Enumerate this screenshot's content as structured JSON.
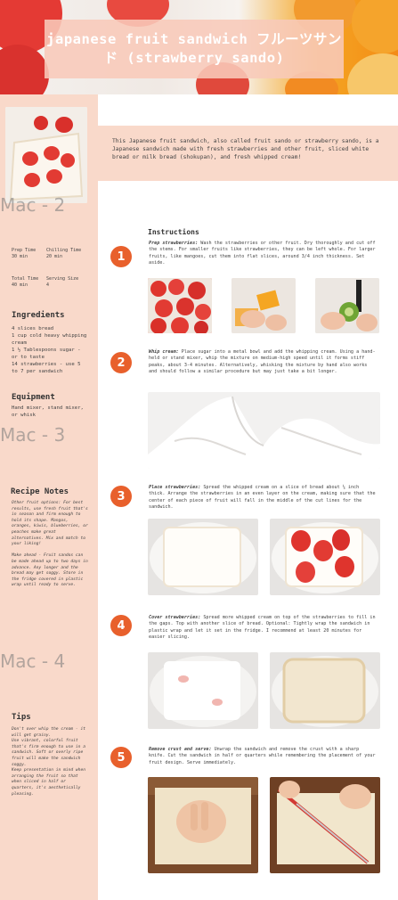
{
  "hero": {
    "title": "japanese fruit sandwich フルーツサンド (strawberry sando)"
  },
  "sidebar": {
    "watermarks": [
      "Mac - 2",
      "Mac - 3",
      "Mac - 4"
    ],
    "meta": {
      "prep_label": "Prep Time",
      "prep_value": "30 min",
      "chill_label": "Chilling Time",
      "chill_value": "20 min",
      "total_label": "Total Time",
      "total_value": "40 min",
      "serving_label": "Serving Size",
      "serving_value": "4"
    },
    "ingredients": {
      "heading": "Ingredients",
      "text": "4 slices bread\n1 cup cold heavy whipping cream\n1 ½ Tablespoons sugar - or to taste\n14 strawberries - use 5 to 7 per sandwich"
    },
    "equipment": {
      "heading": "Equipment",
      "text": "Hand mixer, stand mixer, or whisk"
    },
    "notes": {
      "heading": "Recipe Notes",
      "text": "Other fruit options: For best results, use fresh fruit that's in season and firm enough to hold its shape. Mangos, oranges, kiwis, blueberries, or peaches make great alternatives. Mix and match to your liking!\n\nMake ahead - Fruit sandos can be made ahead up to two days in advance. Any longer and the bread may get soggy. Store in the fridge covered in plastic wrap until ready to serve."
    },
    "tips": {
      "heading": "Tips",
      "text": "Don't over whip the cream - it will get grainy.\nUse vibrant, colorful fruit that's firm enough to use in a sandwich. Soft or overly ripe fruit will make the sandwich soggy.\nKeep presentation in mind when arranging the fruit so that when sliced in half or quarters, it's aesthetically pleasing."
    }
  },
  "intro": {
    "text": "This Japanese fruit sandwich, also called fruit sando or strawberry sando, is a Japanese sandwich made with fresh strawberries and other fruit, sliced white bread or milk bread (shokupan), and fresh whipped cream!"
  },
  "instructions": {
    "heading": "Instructions",
    "steps": [
      {
        "num": "1",
        "title": "Prep strawberries:",
        "text": " Wash the strawberries or other fruit. Dry thoroughly and cut off the stems. For smaller fruits like strawberries, they can be left whole. For larger fruits, like mangoes, cut them into flat slices, around 3/4 inch thickness. Set aside."
      },
      {
        "num": "2",
        "title": "Whip cream:",
        "text": " Place sugar into a metal bowl and add the whipping cream. Using a hand-held or stand mixer, whip the mixture on medium-high speed until it forms stiff peaks, about 3-4 minutes. Alternatively, whisking the mixture by hand also works and should follow a similar procedure but may just take a bit longer."
      },
      {
        "num": "3",
        "title": "Place strawberries:",
        "text": " Spread the whipped cream on a slice of bread about ¼ inch thick. Arrange the strawberries in an even layer on the cream, making sure that the center of each piece of fruit will fall in the middle of the cut lines for the sandwich."
      },
      {
        "num": "4",
        "title": "Cover strawberries:",
        "text": " Spread more whipped cream on top of the strawberries to fill in the gaps. Top with another slice of bread. Optional: Tightly wrap the sandwich in plastic wrap and let it set in the fridge. I recommend at least 20 minutes for easier slicing."
      },
      {
        "num": "5",
        "title": "Remove crust and serve:",
        "text": " Unwrap the sandwich and remove the crust with a sharp knife. Cut the sandwich in half or quarters while remembering the placement of your fruit design. Serve immediately."
      }
    ]
  },
  "colors": {
    "accent": "#e8602c",
    "panel": "#f9d9ca",
    "title_box": "#f8c9ba"
  }
}
